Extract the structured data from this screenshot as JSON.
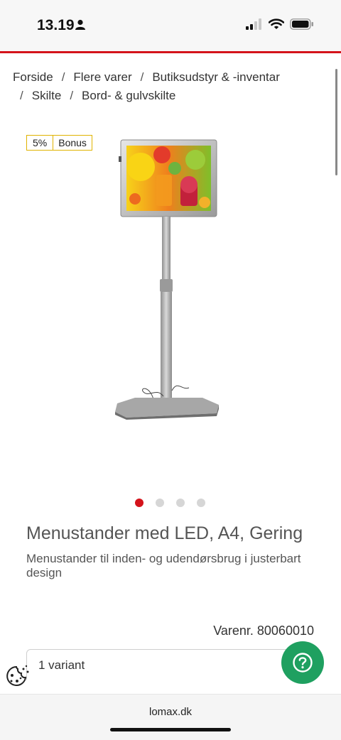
{
  "status_bar": {
    "time": "13.19"
  },
  "breadcrumb": {
    "row1": [
      "Forside",
      "Flere varer",
      "Butiksudstyr & -inventar"
    ],
    "row2": [
      "Skilte",
      "Bord- & gulvskilte"
    ],
    "separator": "/"
  },
  "badge": {
    "percent": "5%",
    "label": "Bonus"
  },
  "carousel": {
    "count": 4,
    "active_index": 0
  },
  "product": {
    "title": "Menustander med LED, A4, Gering",
    "description": "Menustander til inden- og udendørsbrug i justerbart design",
    "sku": "Varenr. 80060010",
    "variant": "1 variant"
  },
  "browser": {
    "url": "lomax.dk"
  },
  "colors": {
    "accent_red": "#d4131b",
    "help_green": "#1fa060",
    "badge_border": "#e0b300"
  },
  "icons": {
    "help": "question-circle-icon",
    "cookie": "cookie-icon"
  }
}
